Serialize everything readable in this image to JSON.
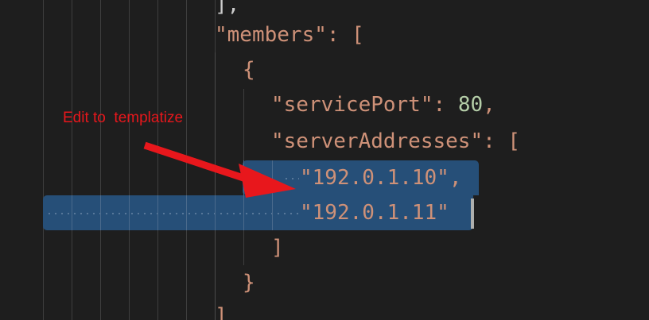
{
  "editor": {
    "lines": [
      {
        "text": "],",
        "kind": "punct"
      },
      {
        "text": "\"members\": [",
        "kind": "key"
      },
      {
        "text": "{",
        "kind": "punct"
      },
      {
        "text": "\"servicePort\": 80,",
        "kind": "key"
      },
      {
        "text": "\"serverAddresses\": [",
        "kind": "key"
      },
      {
        "text": "\"192.0.1.10\",",
        "kind": "string"
      },
      {
        "text": "\"192.0.1.11\"",
        "kind": "string"
      },
      {
        "text": "]",
        "kind": "punct"
      },
      {
        "text": "}",
        "kind": "punct"
      },
      {
        "text": "]",
        "kind": "punct"
      }
    ],
    "colors": {
      "background": "#1e1e1e",
      "string": "#ce9178",
      "selection": "#264f78",
      "cursor": "#aeafad",
      "indent_guide": "#3e3e3e"
    }
  },
  "annotation": {
    "text": "Edit to  templatize",
    "color": "#e8171c",
    "arrow_icon": "arrow-right-down-icon"
  }
}
